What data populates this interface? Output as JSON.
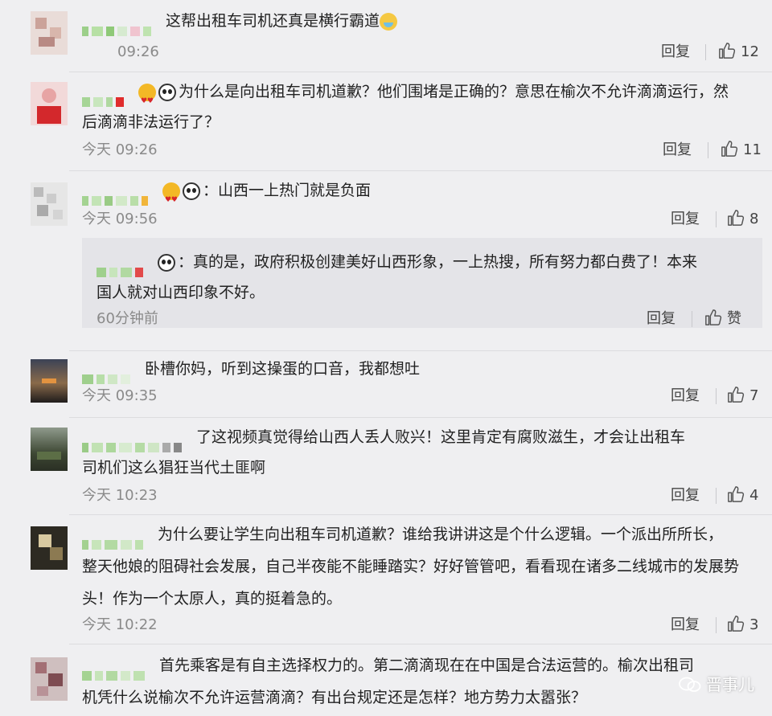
{
  "comments": [
    {
      "text_line1": "这帮出租车司机还真是横行霸道",
      "text_line2": "",
      "time": "09:26",
      "reply": "回复",
      "likes": "12"
    },
    {
      "text_line1": "为什么是向出租车司机道歉？他们围堵是正确的？意思在榆次不允许滴滴运行，然",
      "text_line2": "后滴滴非法运行了？",
      "time": "今天 09:26",
      "reply": "回复",
      "likes": "11"
    },
    {
      "text_line1": "：山西一上热门就是负面",
      "text_line2": "",
      "time": "今天 09:56",
      "reply": "回复",
      "likes": "8",
      "sub_reply": {
        "text_line1": "：真的是，政府积极创建美好山西形象，一上热搜，所有努力都白费了！本来",
        "text_line2": "国人就对山西印象不好。",
        "time": "60分钟前",
        "reply": "回复",
        "like_label": "赞"
      }
    },
    {
      "text_line1": "卧槽你妈，听到这操蛋的口音，我都想吐",
      "text_line2": "",
      "time": "今天 09:35",
      "reply": "回复",
      "likes": "7"
    },
    {
      "text_line1": "了这视频真觉得给山西人丢人败兴！这里肯定有腐败滋生，才会让出租车",
      "text_line2": "司机们这么猖狂当代土匪啊",
      "time": "今天 10:23",
      "reply": "回复",
      "likes": "4"
    },
    {
      "text_line1": "为什么要让学生向出租车司机道歉？谁给我讲讲这是个什么逻辑。一个派出所所长，",
      "text_line2": "整天他娘的阻碍社会发展，自己半夜能不能睡踏实？好好管管吧，看看现在诸多二线城市的发展势",
      "text_line3": "头！作为一个太原人，真的挺着急的。",
      "time": "今天 10:22",
      "reply": "回复",
      "likes": "3"
    },
    {
      "text_line1": "首先乘客是有自主选择权力的。第二滴滴现在在中国是合法运营的。榆次出租司",
      "text_line2": "机凭什么说榆次不允许运营滴滴？有出台规定还是怎样？地方势力太嚣张？",
      "time": "",
      "reply": "",
      "likes": ""
    }
  ],
  "watermark": "晋事儿",
  "colors": {
    "background": "#efeff1",
    "subreply_bg": "#e4e4e8",
    "time": "#8a8a8a"
  }
}
